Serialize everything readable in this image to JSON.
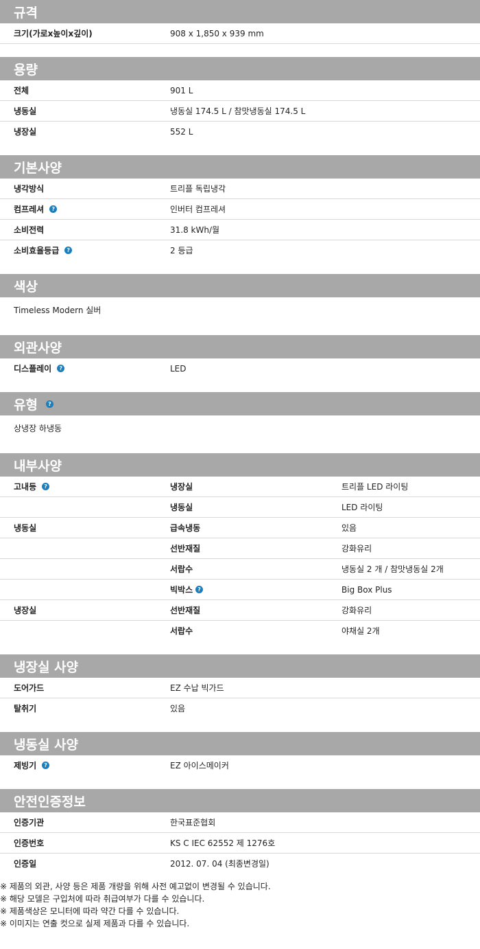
{
  "help_glyph": "?",
  "s1": {
    "title": "규격",
    "rows": [
      {
        "k": "크기(가로x높이x깊이)",
        "v": "908 x 1,850 x 939 mm"
      }
    ]
  },
  "s2": {
    "title": "용량",
    "rows": [
      {
        "k": "전체",
        "v": "901 L"
      },
      {
        "k": "냉동실",
        "v": "냉동실 174.5 L / 참맛냉동실 174.5 L"
      },
      {
        "k": "냉장실",
        "v": "552 L"
      }
    ]
  },
  "s3": {
    "title": "기본사양",
    "rows": [
      {
        "k": "냉각방식",
        "v": "트리플 독립냉각"
      },
      {
        "k": "컴프레셔",
        "v": "인버터 컴프레셔"
      },
      {
        "k": "소비전력",
        "v": "31.8 kWh/월"
      },
      {
        "k": "소비효율등급",
        "v": "2 등급"
      }
    ]
  },
  "s4": {
    "title": "색상",
    "value": "Timeless Modern 실버"
  },
  "s5": {
    "title": "외관사양",
    "rows": [
      {
        "k": "디스플레이",
        "v": "LED"
      }
    ]
  },
  "s6": {
    "title": "유형",
    "value": "상냉장 하냉동"
  },
  "s7": {
    "title": "내부사양",
    "rows": [
      {
        "a": "고내등",
        "b": "냉장실",
        "c": "트리플 LED 라이팅"
      },
      {
        "a": "",
        "b": "냉동실",
        "c": "LED 라이팅"
      },
      {
        "a": "냉동실",
        "b": "급속냉동",
        "c": "있음"
      },
      {
        "a": "",
        "b": "선반재질",
        "c": "강화유리"
      },
      {
        "a": "",
        "b": "서랍수",
        "c": "냉동실 2 개 / 참맛냉동실 2개"
      },
      {
        "a": "",
        "b": "빅박스",
        "c": "Big Box Plus"
      },
      {
        "a": "냉장실",
        "b": "선반재질",
        "c": "강화유리"
      },
      {
        "a": "",
        "b": "서랍수",
        "c": "야채실 2개"
      }
    ]
  },
  "s8": {
    "title": "냉장실 사양",
    "rows": [
      {
        "k": "도어가드",
        "v": "EZ 수납 빅가드"
      },
      {
        "k": "탈취기",
        "v": "있음"
      }
    ]
  },
  "s9": {
    "title": "냉동실 사양",
    "rows": [
      {
        "k": "제빙기",
        "v": "EZ 아이스메이커"
      }
    ]
  },
  "s10": {
    "title": "안전인증정보",
    "rows": [
      {
        "k": "인증기관",
        "v": "한국표준협회"
      },
      {
        "k": "인증번호",
        "v": "KS C IEC 62552 제 1276호"
      },
      {
        "k": "인증일",
        "v": "2012. 07. 04 (최종변경일)"
      }
    ]
  },
  "notes": [
    "※ 제품의 외관, 사양 등은 제품 개량을 위해 사전 예고없이 변경될 수 있습니다.",
    "※ 해당 모델은 구입처에 따라 취급여부가 다를 수 있습니다.",
    "※ 제품색상은 모니터에 따라 약간 다를 수 있습니다.",
    "※ 이미지는 연출 컷으로 실제 제품과 다를 수 있습니다."
  ]
}
